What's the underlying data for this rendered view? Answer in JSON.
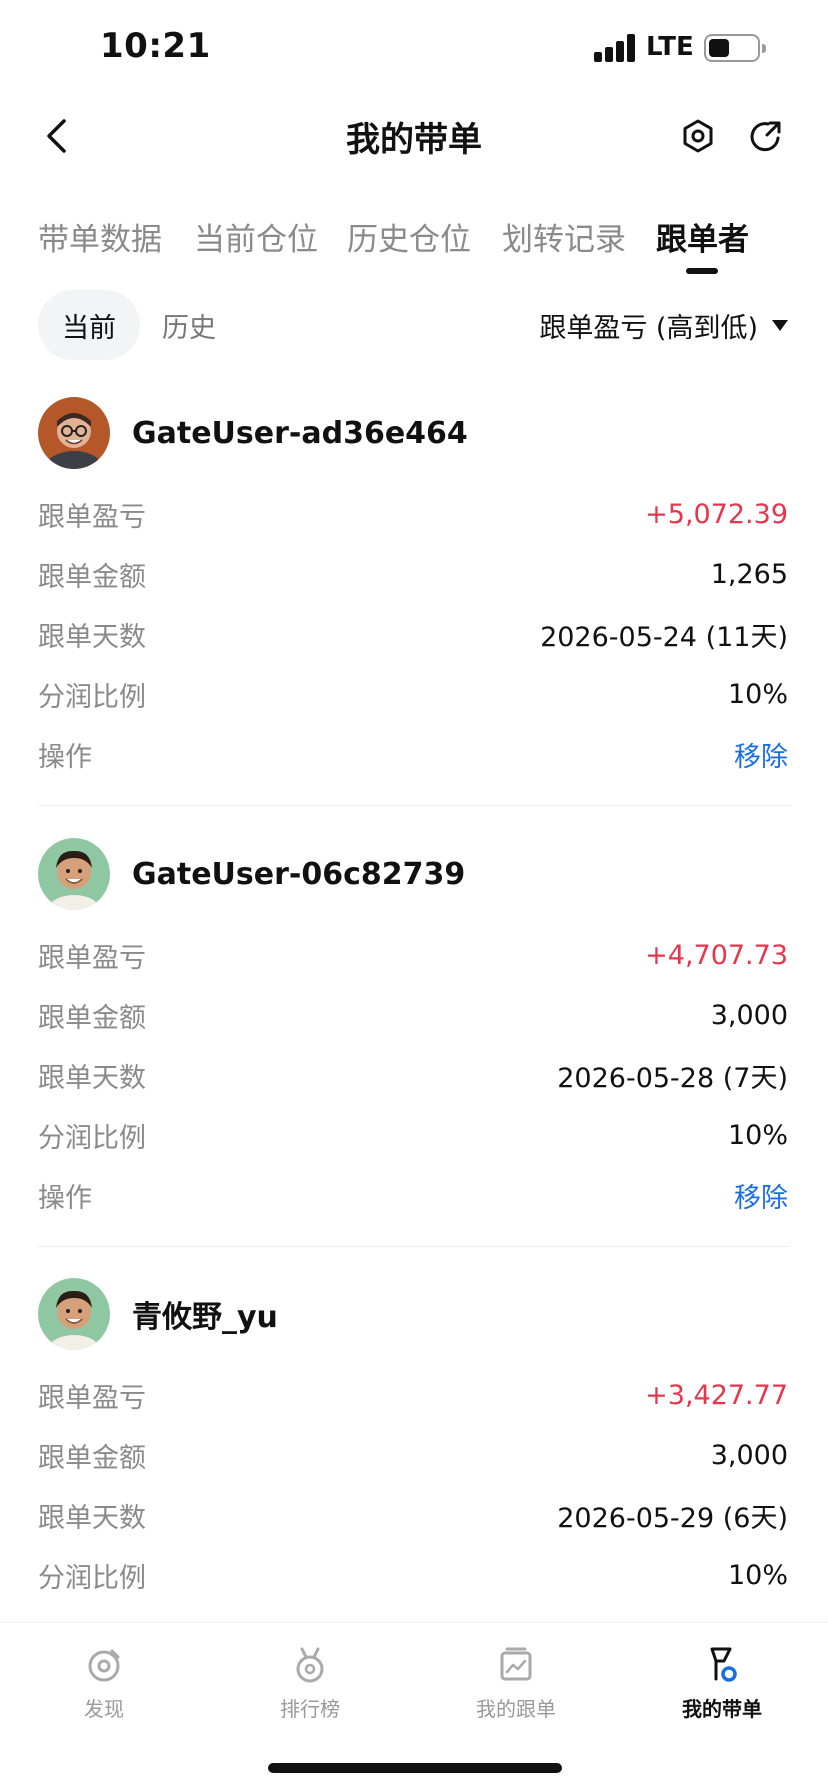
{
  "status_bar": {
    "time": "10:21",
    "network": "LTE"
  },
  "header": {
    "title": "我的带单"
  },
  "tabs": [
    {
      "label": "带单数据"
    },
    {
      "label": "当前仓位"
    },
    {
      "label": "历史仓位"
    },
    {
      "label": "划转记录"
    },
    {
      "label": "跟单者"
    }
  ],
  "active_tab": "跟单者",
  "filter": {
    "current": "当前",
    "history": "历史",
    "sort_label": "跟单盈亏 (高到低)"
  },
  "field_labels": {
    "pnl": "跟单盈亏",
    "amount": "跟单金额",
    "days": "跟单天数",
    "share": "分润比例",
    "action": "操作"
  },
  "followers": [
    {
      "name": "GateUser-ad36e464",
      "pnl": "+5,072.39",
      "amount": "1,265",
      "days": "2026-05-24 (11天)",
      "share": "10%",
      "action": "移除"
    },
    {
      "name": "GateUser-06c82739",
      "pnl": "+4,707.73",
      "amount": "3,000",
      "days": "2026-05-28 (7天)",
      "share": "10%",
      "action": "移除"
    },
    {
      "name": "青攸野_yu",
      "pnl": "+3,427.77",
      "amount": "3,000",
      "days": "2026-05-29 (6天)",
      "share": "10%"
    }
  ],
  "bottom_nav": [
    {
      "label": "发现",
      "icon": "discover-icon"
    },
    {
      "label": "排行榜",
      "icon": "ranking-icon"
    },
    {
      "label": "我的跟单",
      "icon": "my-copy-icon"
    },
    {
      "label": "我的带单",
      "icon": "my-lead-icon"
    }
  ],
  "colors": {
    "profit": "#e5364c",
    "action": "#1a6fe0",
    "muted": "#8a8a8a"
  }
}
